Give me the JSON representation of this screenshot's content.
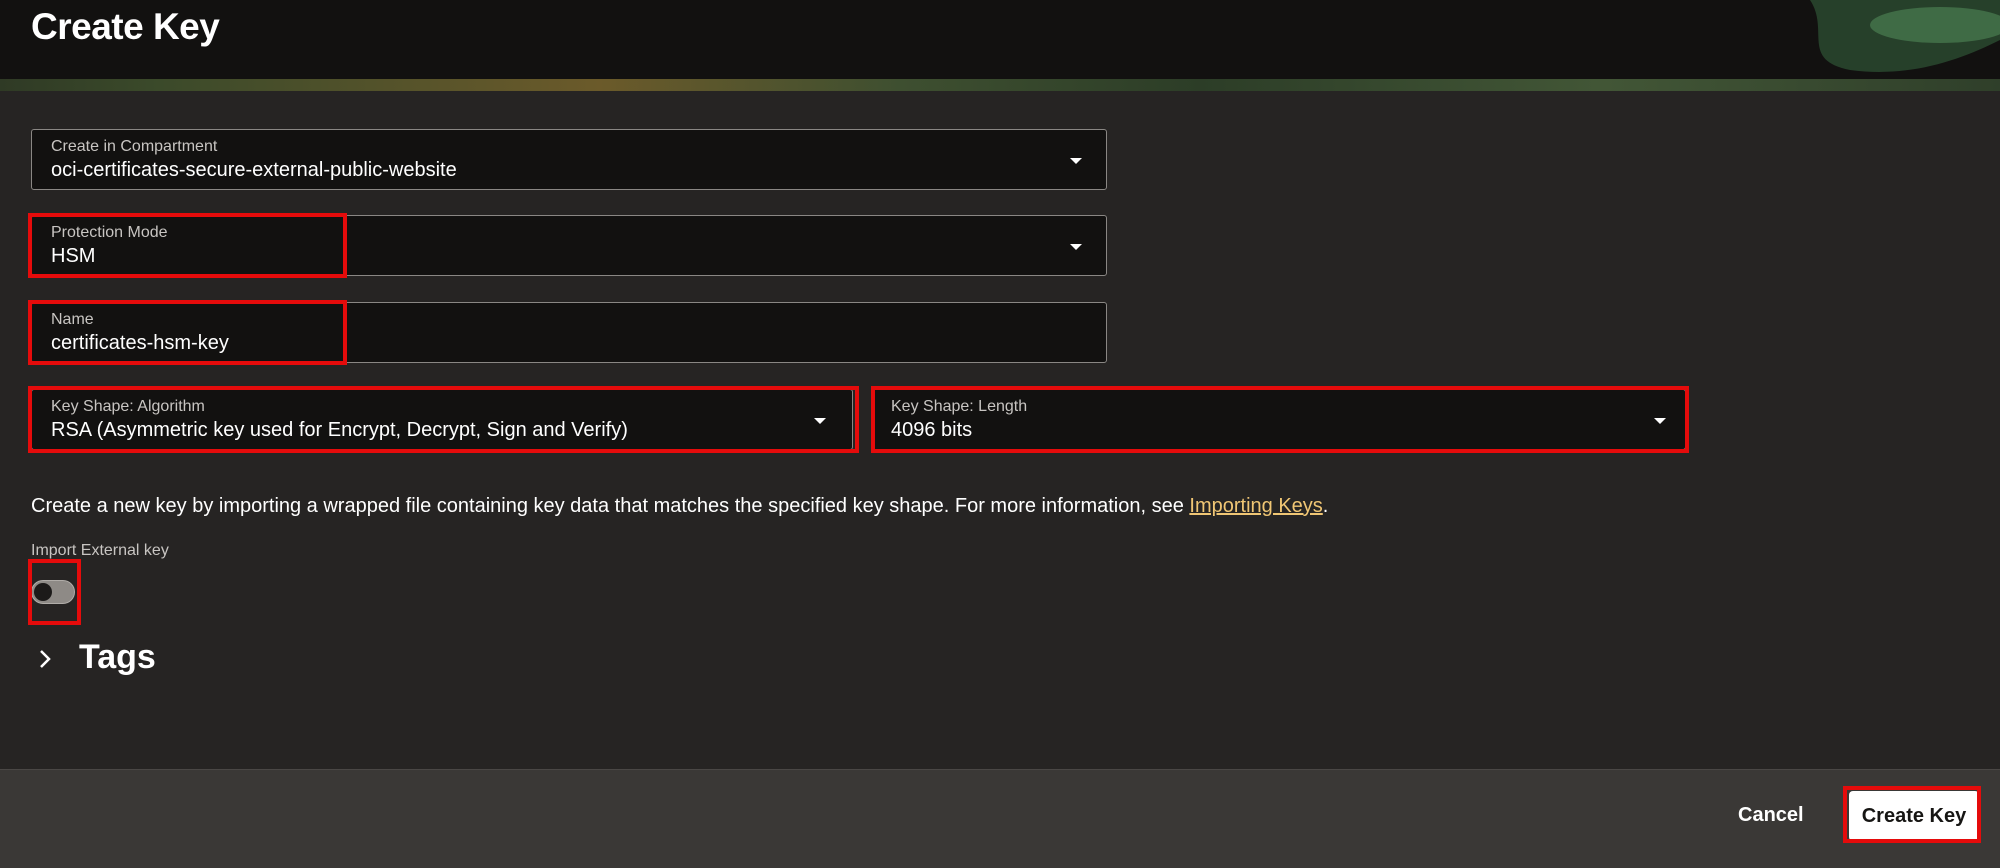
{
  "header": {
    "title": "Create Key"
  },
  "form": {
    "compartment": {
      "label": "Create in Compartment",
      "value": "oci-certificates-secure-external-public-website"
    },
    "protection_mode": {
      "label": "Protection Mode",
      "value": "HSM"
    },
    "name": {
      "label": "Name",
      "value": "certificates-hsm-key"
    },
    "algorithm": {
      "label": "Key Shape: Algorithm",
      "value": "RSA (Asymmetric key used for Encrypt, Decrypt, Sign and Verify)"
    },
    "length": {
      "label": "Key Shape: Length",
      "value": "4096 bits"
    },
    "info": {
      "text": "Create a new key by importing a wrapped file containing key data that matches the specified key shape. For more information, see ",
      "link": "Importing Keys",
      "suffix": "."
    },
    "import_toggle": {
      "label": "Import External key",
      "checked": false
    },
    "tags": {
      "title": "Tags"
    }
  },
  "footer": {
    "cancel_label": "Cancel",
    "create_label": "Create Key"
  },
  "colors": {
    "highlight": "#e50b0b",
    "link": "#f0c674",
    "background": "#262423",
    "field_bg": "#121110"
  },
  "icons": [
    "chevron-down-icon",
    "chevron-right-icon"
  ]
}
